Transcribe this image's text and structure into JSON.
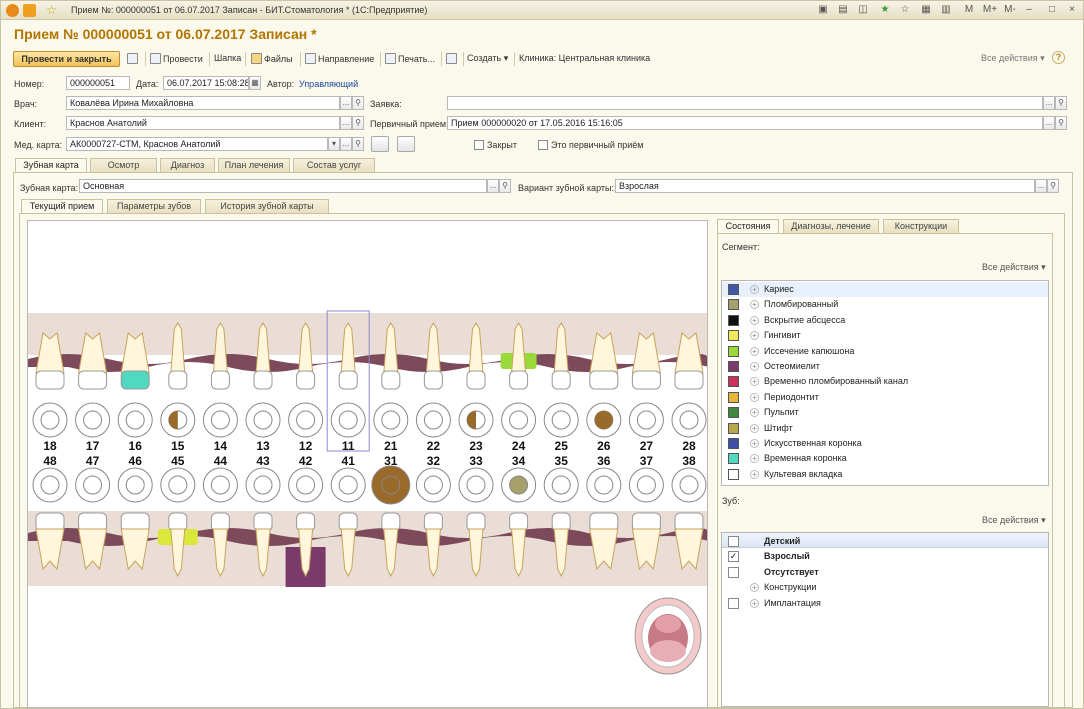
{
  "window": {
    "title": "Прием №: 000000051 от 06.07.2017 Записан - БИТ.Стоматология *   (1С:Предприятие)",
    "controls": [
      "M",
      "M+",
      "M-",
      "–",
      "□",
      "×"
    ]
  },
  "doc_title": "Прием № 000000051 от 06.07.2017 Записан *",
  "toolbar": {
    "post_close": "Провести и закрыть",
    "post": "Провести",
    "hat": "Шапка",
    "files": "Файлы",
    "referral": "Направление",
    "print": "Печать...",
    "create": "Создать",
    "clinic": "Клиника: Центральная клиника",
    "all_actions": "Все действия",
    "help": "?"
  },
  "form": {
    "number_label": "Номер:",
    "number": "000000051",
    "date_label": "Дата:",
    "date": "06.07.2017 15:08:28",
    "author_label": "Автор:",
    "author": "Управляющий",
    "doctor_label": "Врач:",
    "doctor": "Ковалёва Ирина Михайловна",
    "request_label": "Заявка:",
    "request": "",
    "client_label": "Клиент:",
    "client": "Краснов Анатолий",
    "primary_label": "Первичный прием:",
    "primary": "Прием 000000020 от 17.05.2016 15:16:05",
    "card_label": "Мед. карта:",
    "card": "АК0000727-СТМ, Краснов Анатолий",
    "closed_label": "Закрыт",
    "first_visit_label": "Это первичный приём"
  },
  "main_tabs": [
    "Зубная карта",
    "Осмотр",
    "Диагноз",
    "План лечения",
    "Состав услуг"
  ],
  "dental": {
    "map_label": "Зубная карта:",
    "map": "Основная",
    "variant_label": "Вариант зубной карты:",
    "variant": "Взрослая"
  },
  "sub_tabs": [
    "Текущий прием",
    "Параметры зубов",
    "История зубной карты"
  ],
  "teeth": {
    "upper": [
      "18",
      "17",
      "16",
      "15",
      "14",
      "13",
      "12",
      "11",
      "21",
      "22",
      "23",
      "24",
      "25",
      "26",
      "27",
      "28"
    ],
    "lower": [
      "48",
      "47",
      "46",
      "45",
      "44",
      "43",
      "42",
      "41",
      "31",
      "32",
      "33",
      "34",
      "35",
      "36",
      "37",
      "38"
    ]
  },
  "right_tabs": [
    "Состояния",
    "Диагнозы, лечение",
    "Конструкции"
  ],
  "segment_label": "Сегмент:",
  "all_actions": "Все действия",
  "states": [
    {
      "label": "Кариес",
      "color": "#3f57a8"
    },
    {
      "label": "Пломбированный",
      "color": "#a6a06a"
    },
    {
      "label": "Вскрытие абсцесса",
      "color": "#111111"
    },
    {
      "label": "Гингивит",
      "color": "#f2e85a"
    },
    {
      "label": "Иссечение капюшона",
      "color": "#9bd83a"
    },
    {
      "label": "Остеомиелит",
      "color": "#7a3b6b"
    },
    {
      "label": "Временно пломбированный канал",
      "color": "#c9315a"
    },
    {
      "label": "Периодонтит",
      "color": "#e7b53a"
    },
    {
      "label": "Пульпит",
      "color": "#3f8a3f"
    },
    {
      "label": "Штифт",
      "color": "#b9a84a"
    },
    {
      "label": "Искусственная коронка",
      "color": "#3e4fa8"
    },
    {
      "label": "Временная коронка",
      "color": "#4fd9c0"
    },
    {
      "label": "Культевая вкладка",
      "color": "#ffffff"
    }
  ],
  "tooth_label": "Зуб:",
  "tooth_types": [
    {
      "label": "Детский",
      "checked": false,
      "plus": false,
      "bold": true
    },
    {
      "label": "Взрослый",
      "checked": true,
      "plus": false,
      "bold": true
    },
    {
      "label": "Отсутствует",
      "checked": false,
      "plus": false,
      "bold": true
    },
    {
      "label": "Конструкции",
      "checked": null,
      "plus": true,
      "bold": false
    },
    {
      "label": "Имплантация",
      "checked": false,
      "plus": true,
      "bold": false
    }
  ]
}
